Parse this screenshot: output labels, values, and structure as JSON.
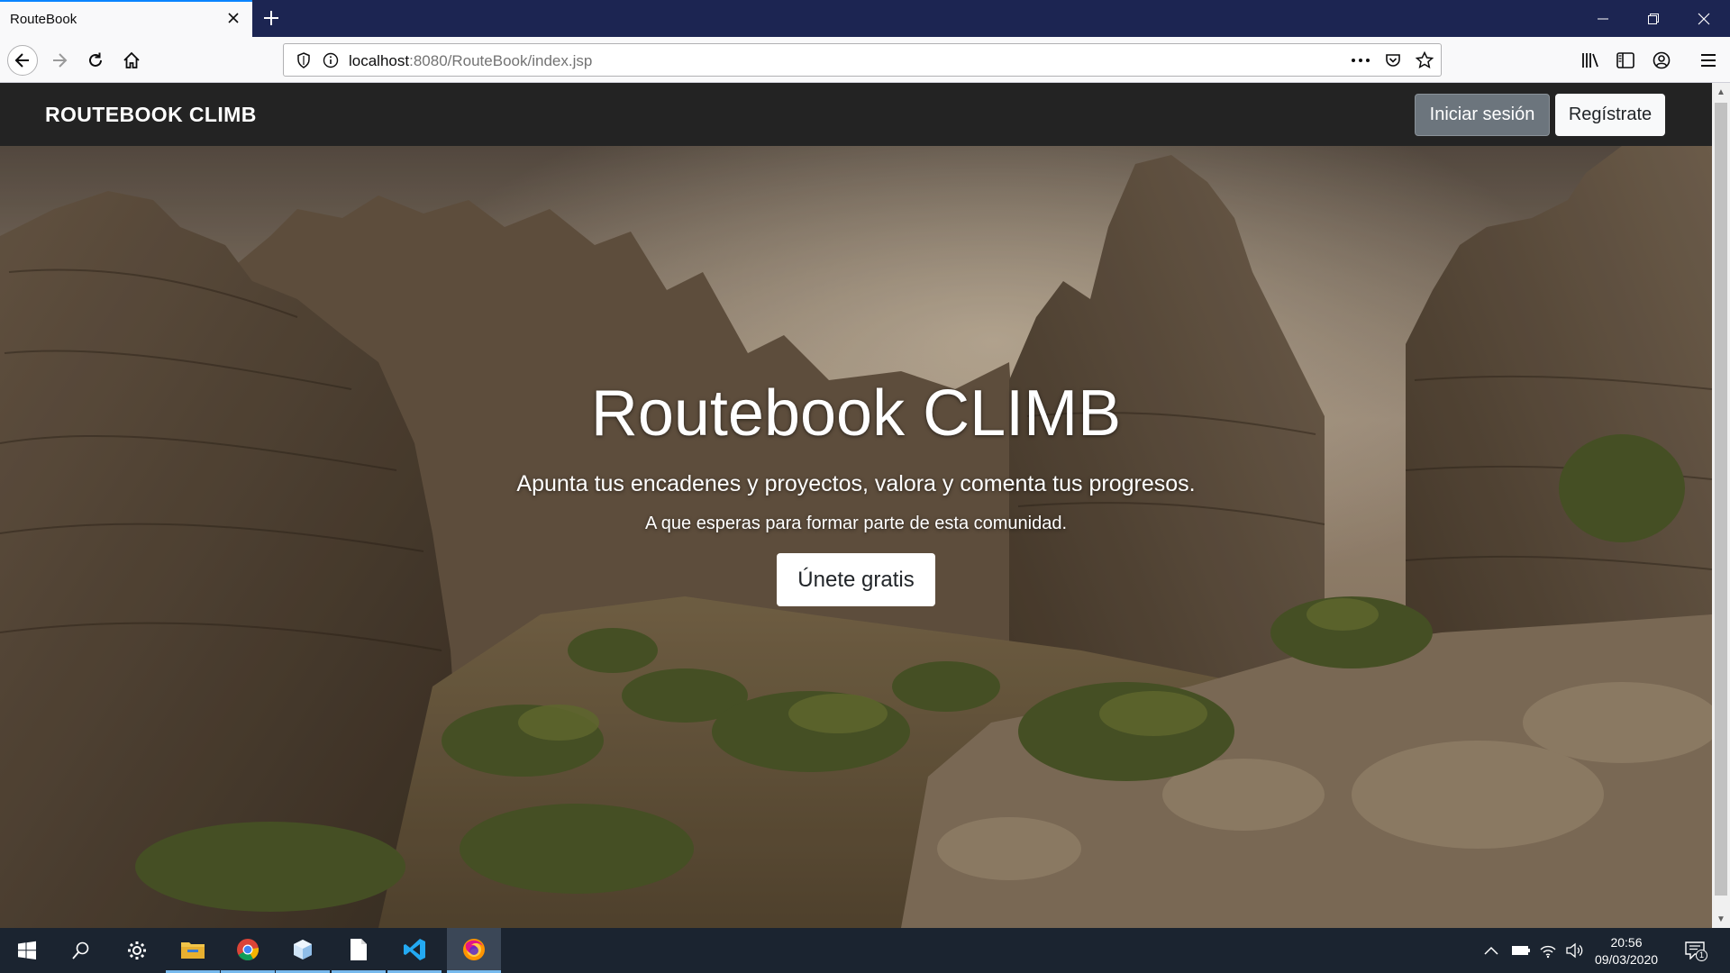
{
  "browser": {
    "tab_title": "RouteBook",
    "url_host": "localhost",
    "url_path": ":8080/RouteBook/index.jsp"
  },
  "site": {
    "brand_part1": "ROUTEBOOK ",
    "brand_part2": "CLIMB",
    "login_label": "Iniciar sesión",
    "register_label": "Regístrate"
  },
  "hero": {
    "title": "Routebook CLIMB",
    "subtitle": "Apunta tus encadenes y proyectos, valora y comenta tus progresos.",
    "tagline": "A que esperas para formar parte de esta comunidad.",
    "cta_label": "Únete gratis"
  },
  "taskbar": {
    "time": "20:56",
    "date": "09/03/2020",
    "notification_count": "1"
  },
  "colors": {
    "tab_strip": "#1c2552",
    "site_nav": "#232323",
    "accent": "#0a84ff",
    "login_button": "#6c757d",
    "taskbar": "#1b2430"
  },
  "icons": [
    "back-icon",
    "forward-icon",
    "reload-icon",
    "home-icon",
    "shield-icon",
    "info-icon",
    "page-actions-icon",
    "pocket-icon",
    "bookmark-star-icon",
    "library-icon",
    "sidebar-icon",
    "account-icon",
    "menu-icon",
    "windows-start-icon",
    "search-icon",
    "settings-icon",
    "file-explorer-icon",
    "chrome-icon",
    "box-app-icon",
    "document-icon",
    "vscode-icon",
    "firefox-icon"
  ]
}
